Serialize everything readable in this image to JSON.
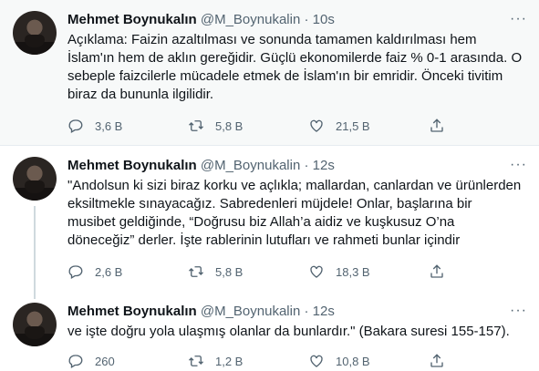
{
  "tweets": [
    {
      "name": "Mehmet Boynukalın",
      "handle": "@M_Boynukalin",
      "separator": "·",
      "time": "10s",
      "text": "Açıklama: Faizin azaltılması ve sonunda tamamen kaldırılması hem İslam'ın hem de aklın gereğidir. Güçlü ekonomilerde faiz % 0-1 arasında. O sebeple faizcilerle mücadele etmek de İslam'ın bir emridir. Önceki tivitim biraz da bununla ilgilidir.",
      "replies": "3,6 B",
      "retweets": "5,8 B",
      "likes": "21,5 B"
    },
    {
      "name": "Mehmet Boynukalın",
      "handle": "@M_Boynukalin",
      "separator": "·",
      "time": "12s",
      "text": "\"Andolsun ki sizi biraz korku ve açlıkla; mallardan, canlardan ve ürünlerden eksiltmekle sınayacağız. Sabredenleri müjdele! Onlar, başlarına bir musibet geldiğinde, “Doğrusu biz Allah’a aidiz ve kuşkusuz O’na döneceğiz” derler. İşte rablerinin lutufları ve rahmeti bunlar içindir",
      "replies": "2,6 B",
      "retweets": "5,8 B",
      "likes": "18,3 B"
    },
    {
      "name": "Mehmet Boynukalın",
      "handle": "@M_Boynukalin",
      "separator": "·",
      "time": "12s",
      "text": "ve işte doğru yola ulaşmış olanlar da bunlardır.\" (Bakara suresi 155-157).",
      "replies": "260",
      "retweets": "1,2 B",
      "likes": "10,8 B"
    }
  ],
  "icons": {
    "more": "more-icon",
    "reply": "reply-icon",
    "retweet": "retweet-icon",
    "like": "heart-icon",
    "share": "share-icon"
  },
  "colors": {
    "text": "#0f1419",
    "muted": "#536471",
    "highlight_bg": "#f7f9f9",
    "thread_line": "#cfd9de"
  }
}
